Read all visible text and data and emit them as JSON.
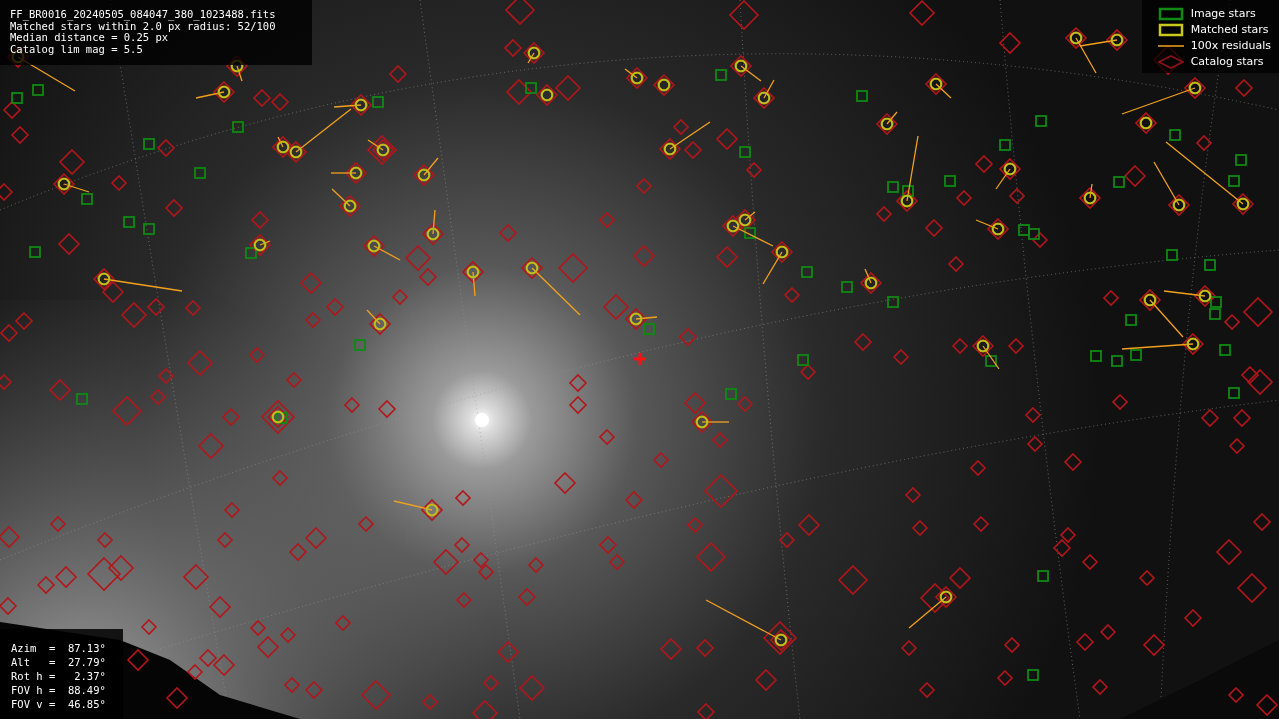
{
  "info_panel": {
    "lines": [
      "FF_BR0016_20240505_084047_380_1023488.fits",
      "Matched stars within 2.0 px radius: 52/100",
      "Median distance = 0.25 px",
      "Catalog lim mag = 5.5"
    ]
  },
  "legend": {
    "items": [
      {
        "kind": "image",
        "label": "Image stars"
      },
      {
        "kind": "matched",
        "label": "Matched stars"
      },
      {
        "kind": "residual",
        "label": "100x residuals"
      },
      {
        "kind": "catalog",
        "label": "Catalog stars"
      }
    ]
  },
  "camera_panel": {
    "lines": [
      "Azim  =  87.13°",
      "Alt   =  27.79°",
      "Rot h =   2.37°",
      "FOV h =  88.49°",
      "FOV v =  46.85°"
    ]
  }
}
